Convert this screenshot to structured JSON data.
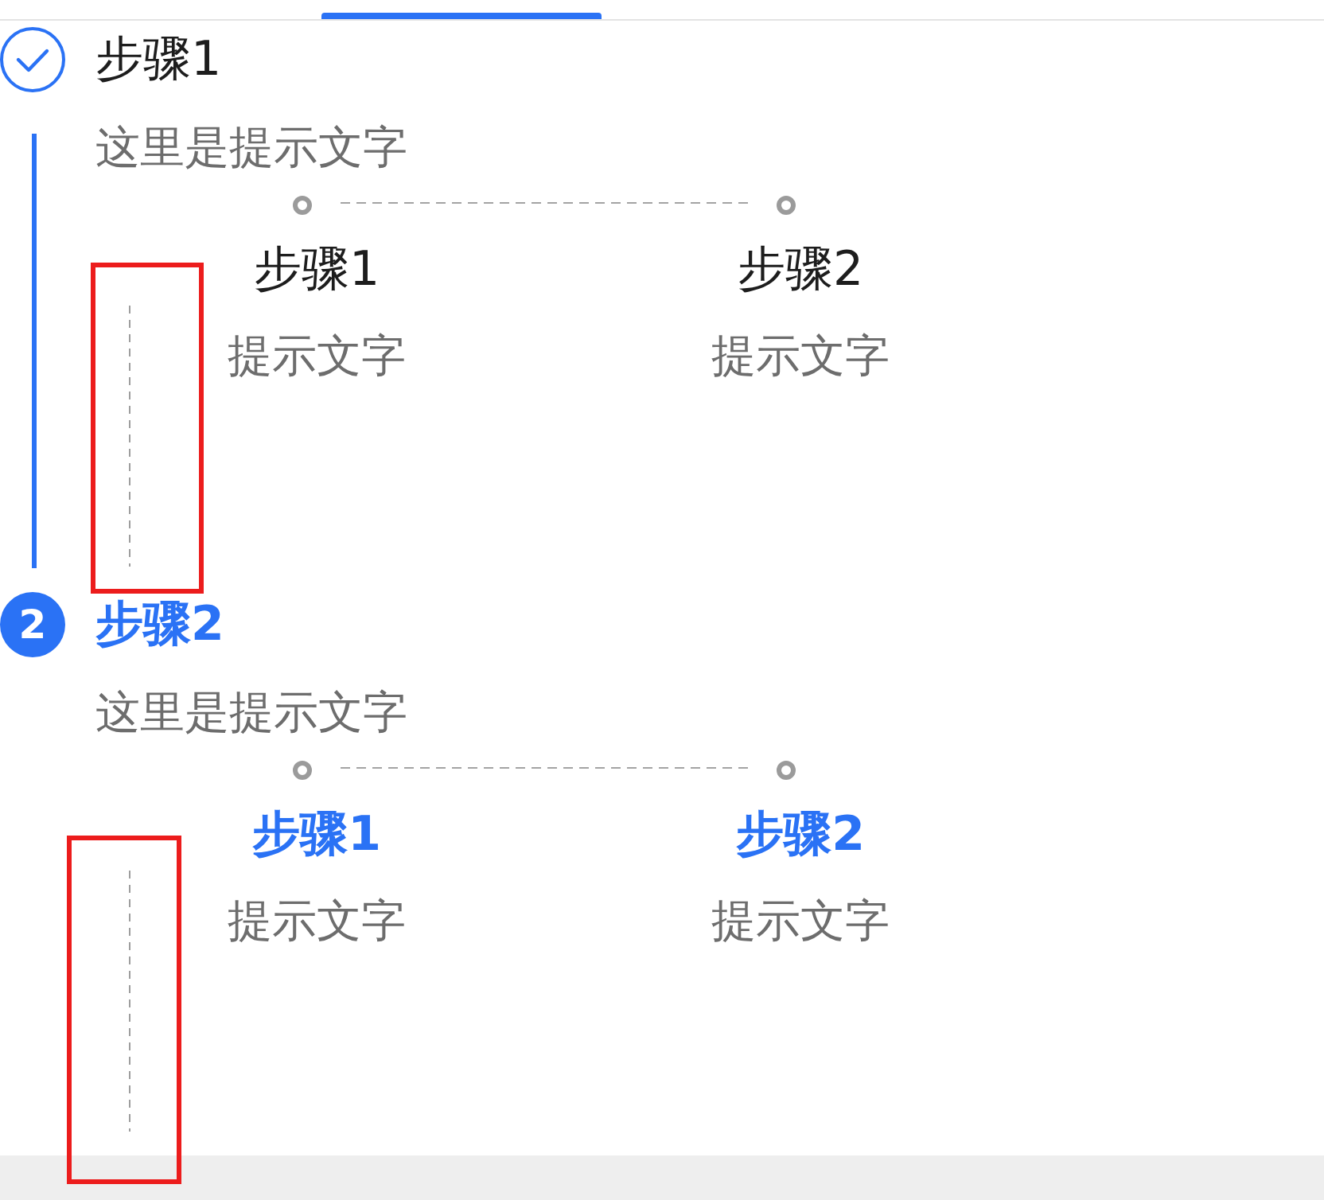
{
  "steps": [
    {
      "title": "步骤1",
      "done": true,
      "selected": false,
      "description": "这里是提示文字",
      "substeps": [
        {
          "title": "步骤1",
          "description": "提示文字",
          "active": false
        },
        {
          "title": "步骤2",
          "description": "提示文字",
          "active": false
        }
      ]
    },
    {
      "title": "步骤2",
      "done": false,
      "selected": true,
      "number": "2",
      "description": "这里是提示文字",
      "substeps": [
        {
          "title": "步骤1",
          "description": "提示文字",
          "active": true
        },
        {
          "title": "步骤2",
          "description": "提示文字",
          "active": true
        }
      ]
    }
  ]
}
